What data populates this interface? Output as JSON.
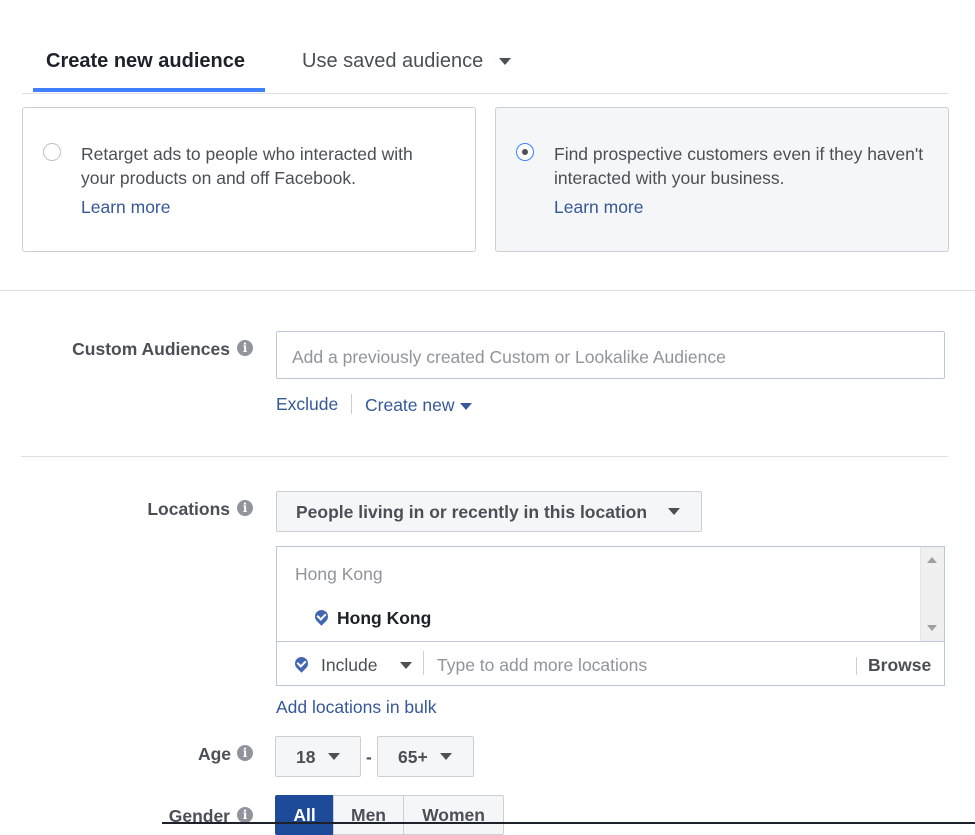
{
  "tabs": {
    "create_new": "Create new audience",
    "use_saved": "Use saved audience"
  },
  "options": {
    "retarget": {
      "text": "Retarget ads to people who interacted with your products on and off Facebook.",
      "link": "Learn more",
      "selected": false
    },
    "prospect": {
      "text": "Find prospective customers even if they haven't interacted with your business.",
      "link": "Learn more",
      "selected": true
    }
  },
  "custom_audiences": {
    "label": "Custom Audiences",
    "info_icon": "i",
    "placeholder": "Add a previously created Custom or Lookalike Audience",
    "exclude": "Exclude",
    "create_new": "Create new"
  },
  "locations": {
    "label": "Locations",
    "info_icon": "i",
    "type": "People living in or recently in this location",
    "group": "Hong Kong",
    "items": [
      "Hong Kong"
    ],
    "include": "Include",
    "placeholder": "Type to add more locations",
    "browse": "Browse",
    "bulk_link": "Add locations in bulk"
  },
  "age": {
    "label": "Age",
    "info_icon": "i",
    "min": "18",
    "dash": "-",
    "max": "65+"
  },
  "gender": {
    "label": "Gender",
    "info_icon": "i",
    "options": [
      "All",
      "Men",
      "Women"
    ],
    "selected": "All"
  },
  "colors": {
    "accent": "#4080ff",
    "link": "#365899",
    "selected_button": "#1d4b9a"
  }
}
